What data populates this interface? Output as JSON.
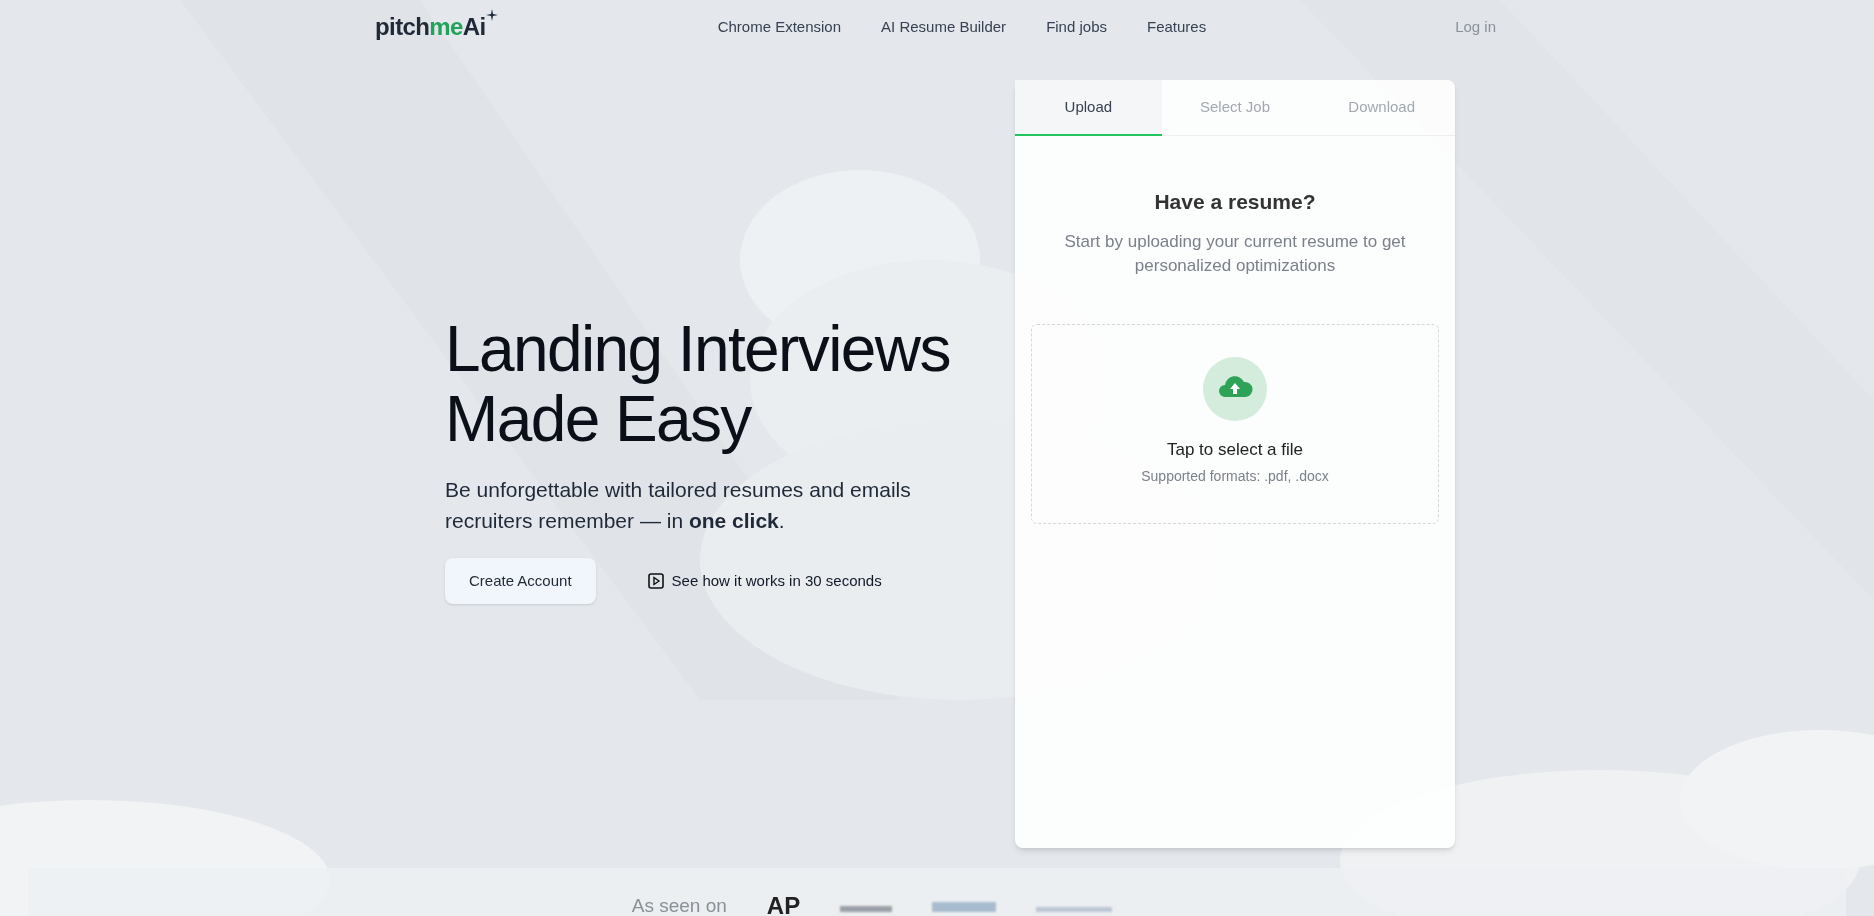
{
  "logo": {
    "segments": [
      {
        "text": "pitch",
        "color": "#1f2937"
      },
      {
        "text": "me",
        "color": "#22a35a"
      },
      {
        "text": "Ai",
        "color": "#1f2937"
      }
    ]
  },
  "nav": {
    "links": [
      "Chrome Extension",
      "AI Resume Builder",
      "Find jobs",
      "Features"
    ],
    "login": "Log in"
  },
  "hero": {
    "title_lines": [
      "Landing Interviews",
      "Made Easy"
    ],
    "subtitle": "Be unforgettable with tailored resumes and emails recruiters remember — in **one click**.",
    "primary_button": "Create Account",
    "video_link": "See how it works in 30 seconds"
  },
  "card": {
    "tabs": [
      {
        "label": "Upload",
        "selected": true
      },
      {
        "label": "Select Job",
        "selected": false
      },
      {
        "label": "Download",
        "selected": false
      }
    ],
    "heading": "Have a resume?",
    "description": "Start by uploading your current resume to get personalized optimizations",
    "dropzone": {
      "label": "Tap to select a file",
      "formats": "Supported formats: .pdf, .docx"
    }
  },
  "press": {
    "label": "As seen on",
    "logos": [
      "AP"
    ]
  }
}
